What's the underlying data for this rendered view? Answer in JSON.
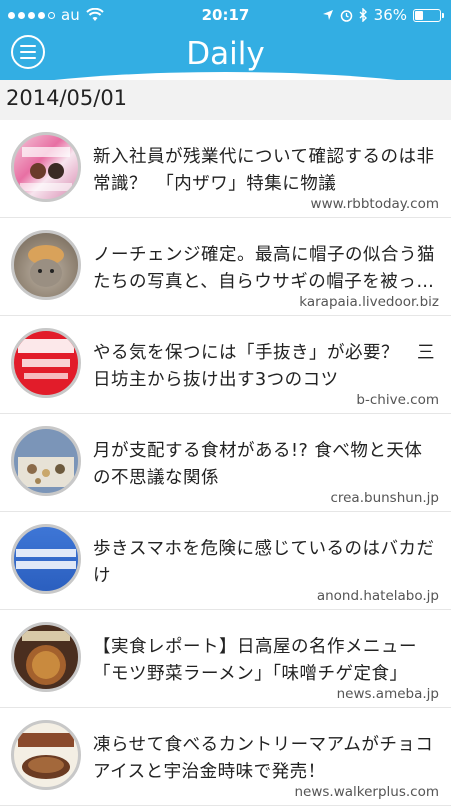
{
  "status_bar": {
    "carrier": "au",
    "time": "20:17",
    "battery": "36%",
    "battery_level": 0.36,
    "icons": [
      "signal-dots-icon",
      "wifi-icon",
      "location-arrow-icon",
      "alarm-icon",
      "bluetooth-icon",
      "battery-icon"
    ]
  },
  "header": {
    "title": "Daily",
    "menu_icon": "hamburger-menu-icon"
  },
  "colors": {
    "header_bg": "#33aee3",
    "background": "#f2f2f2"
  },
  "date": "2014/05/01",
  "articles": [
    {
      "title": "新入社員が残業代について確認するのは非常識？　「内ザワ」特集に物議",
      "domain": "www.rbbtoday.com"
    },
    {
      "title": "ノーチェンジ確定。最高に帽子の似合う猫たちの写真と、自らウサギの帽子を被った猫",
      "domain": "karapaia.livedoor.biz"
    },
    {
      "title": "やる気を保つには「手抜き」が必要？　三日坊主から抜け出す3つのコツ",
      "domain": "b-chive.com"
    },
    {
      "title": "月が支配する食材がある!? 食べ物と天体の不思議な関係",
      "domain": "crea.bunshun.jp"
    },
    {
      "title": "歩きスマホを危険に感じているのはバカだけ",
      "domain": "anond.hatelabo.jp"
    },
    {
      "title": "【実食レポート】日高屋の名作メニュー「モツ野菜ラーメン」「味噌チゲ定食」",
      "domain": "news.ameba.jp"
    },
    {
      "title": "凍らせて食べるカントリーマアムがチョコアイスと宇治金時味で発売！",
      "domain": "news.walkerplus.com"
    }
  ]
}
